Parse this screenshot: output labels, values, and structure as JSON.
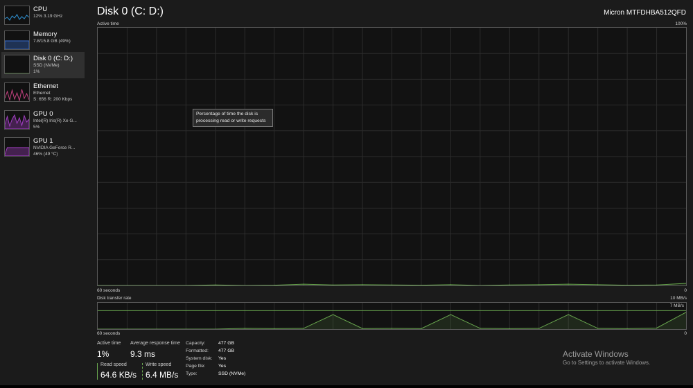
{
  "sidebar": {
    "items": [
      {
        "title": "CPU",
        "sub1": "12% 3.19 GHz",
        "sub2": "",
        "sub3": "",
        "color": "#2f93d6",
        "icon": "cpu-graph-thumbnail"
      },
      {
        "title": "Memory",
        "sub1": "7.8/15.8 GB (49%)",
        "sub2": "",
        "sub3": "",
        "color": "#3a6fd1",
        "icon": "memory-graph-thumbnail"
      },
      {
        "title": "Disk 0 (C: D:)",
        "sub1": "SSD (NVMe)",
        "sub2": "1%",
        "sub3": "",
        "color": "#6aa84f",
        "icon": "disk-graph-thumbnail"
      },
      {
        "title": "Ethernet",
        "sub1": "Ethernet",
        "sub2": "S: 656 R: 200 Kbps",
        "sub3": "",
        "color": "#c2407e",
        "icon": "ethernet-graph-thumbnail"
      },
      {
        "title": "GPU 0",
        "sub1": "Intel(R) Iris(R) Xe G...",
        "sub2": "5%",
        "sub3": "",
        "color": "#a23fc4",
        "icon": "gpu0-graph-thumbnail"
      },
      {
        "title": "GPU 1",
        "sub1": "NVIDIA GeForce R...",
        "sub2": "46% (49 °C)",
        "sub3": "",
        "color": "#a23fc4",
        "icon": "gpu1-graph-thumbnail"
      }
    ]
  },
  "main": {
    "title": "Disk 0 (C: D:)",
    "device": "Micron MTFDHBA512QFD"
  },
  "active_graph": {
    "label": "Active time",
    "max_label": "100%",
    "time_label": "60 seconds",
    "min_label": "0",
    "line_color": "#6aa84f"
  },
  "transfer_graph": {
    "label": "Disk transfer rate",
    "max_label": "10 MB/s",
    "ref_label": "7 MB/s",
    "time_label": "60 seconds",
    "min_label": "0",
    "line_color": "#6aa84f"
  },
  "tooltip": {
    "line1": "Percentage of time the disk is",
    "line2": "processing read or write requests"
  },
  "stats": {
    "active_time_label": "Active time",
    "active_time_value": "1%",
    "avg_response_label": "Average response time",
    "avg_response_value": "9.3 ms",
    "read_label": "Read speed",
    "read_value": "64.6 KB/s",
    "write_label": "Write speed",
    "write_value": "6.4 MB/s",
    "read_color": "#6aa84f",
    "write_color": "#6aa84f"
  },
  "info": {
    "rows": [
      {
        "label": "Capacity:",
        "value": "477 GB"
      },
      {
        "label": "Formatted:",
        "value": "477 GB"
      },
      {
        "label": "System disk:",
        "value": "Yes"
      },
      {
        "label": "Page file:",
        "value": "Yes"
      },
      {
        "label": "Type:",
        "value": "SSD (NVMe)"
      }
    ]
  },
  "watermark": {
    "title": "Activate Windows",
    "sub": "Go to Settings to activate Windows."
  },
  "chart_data": [
    {
      "type": "line",
      "title": "Active time",
      "xlabel": "60 seconds",
      "ylabel": "",
      "ylim": [
        0,
        100
      ],
      "x": [
        0,
        3,
        6,
        9,
        12,
        15,
        18,
        21,
        24,
        27,
        30,
        33,
        36,
        39,
        42,
        45,
        48,
        51,
        54,
        57,
        60
      ],
      "series": [
        {
          "values": [
            0,
            0,
            0,
            0,
            0.2,
            0,
            0.1,
            0.5,
            0.2,
            0.3,
            0.2,
            0.1,
            0.3,
            0,
            0.2,
            0.3,
            0.5,
            0.3,
            0.1,
            0.2,
            0.8
          ]
        }
      ]
    },
    {
      "type": "line",
      "title": "Disk transfer rate",
      "xlabel": "60 seconds",
      "ylabel": "",
      "ylim": [
        0,
        10
      ],
      "x": [
        0,
        3,
        6,
        9,
        12,
        15,
        18,
        21,
        24,
        27,
        30,
        33,
        36,
        39,
        42,
        45,
        48,
        51,
        54,
        57,
        60
      ],
      "series": [
        {
          "values": [
            0,
            0,
            0,
            0,
            0,
            0.3,
            0.2,
            0.3,
            5.5,
            0.2,
            0.3,
            0.2,
            5.5,
            0.3,
            0.2,
            0.3,
            5.5,
            0.3,
            0.2,
            0.4,
            6.4
          ]
        }
      ]
    }
  ]
}
